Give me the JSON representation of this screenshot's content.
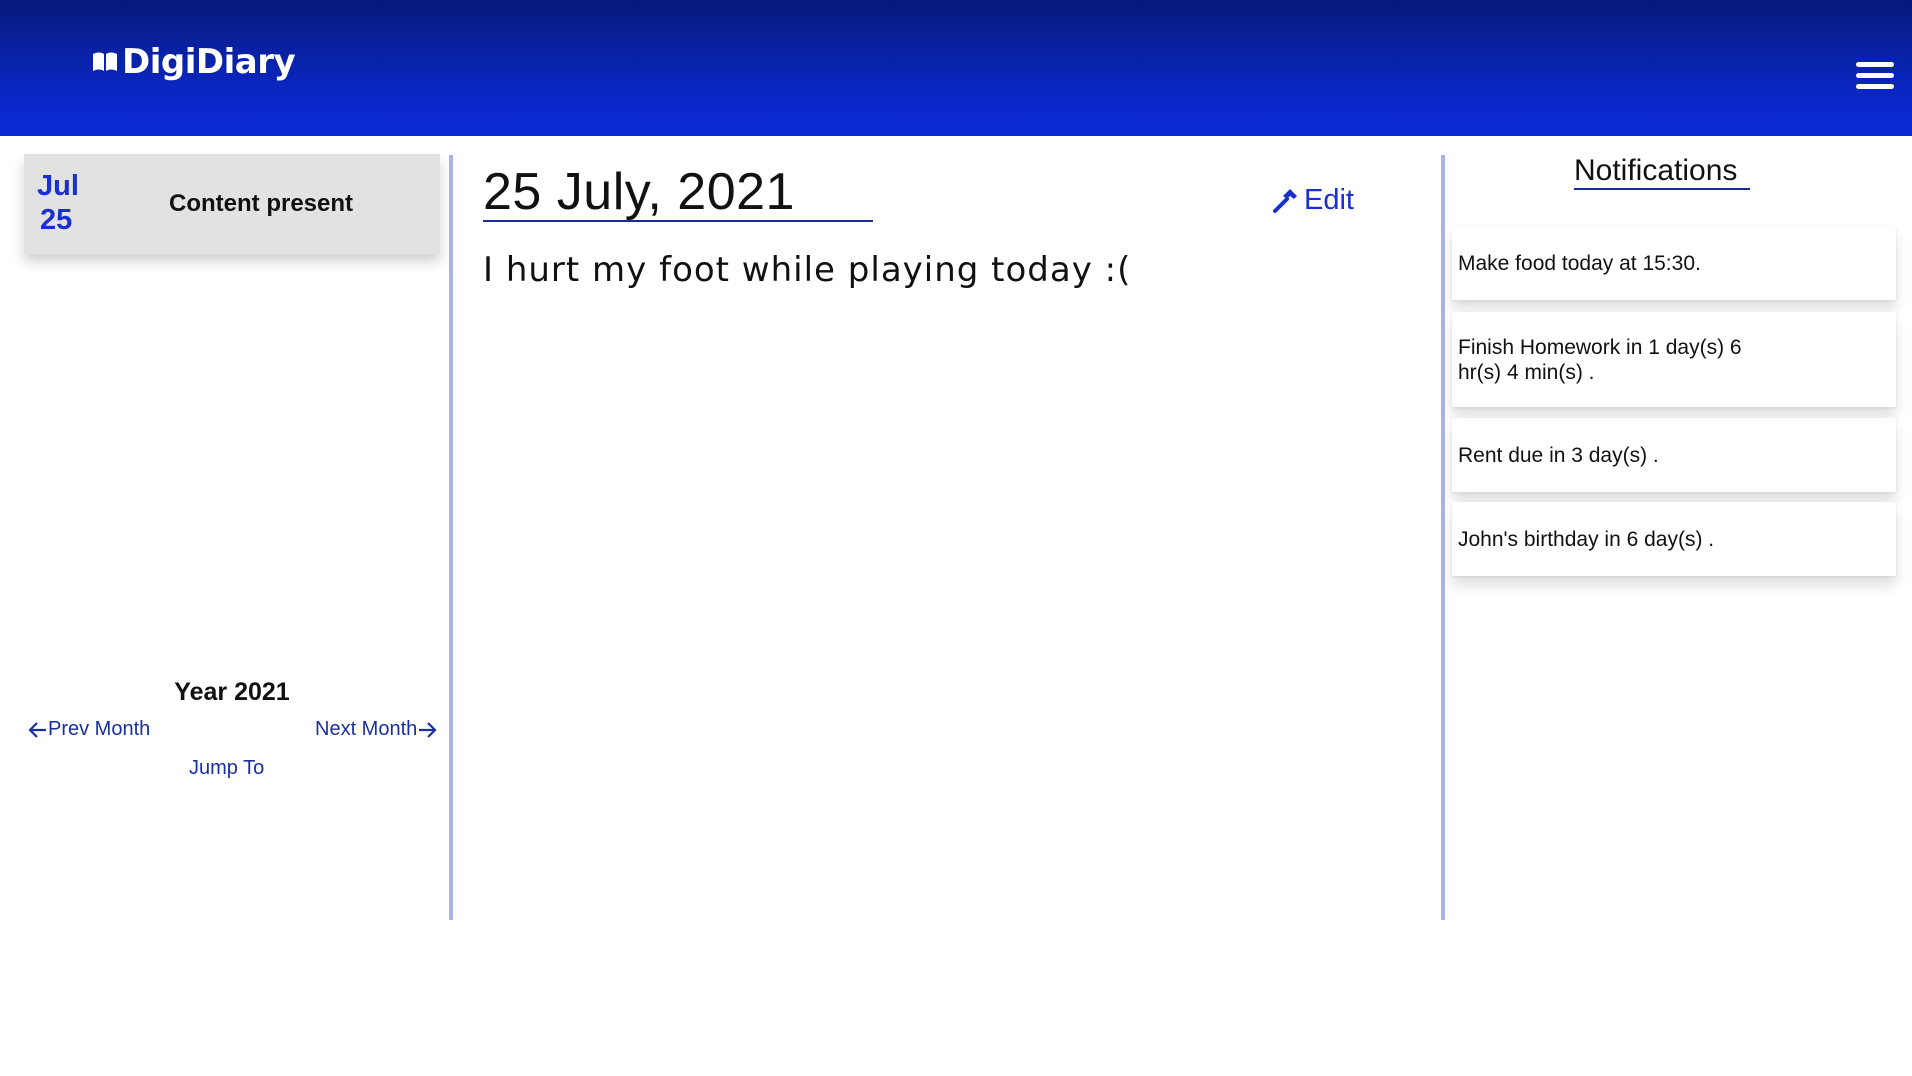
{
  "header": {
    "app_name": "DigiDiary",
    "logo_icon": "book-icon",
    "menu_icon": "hamburger-menu-icon",
    "gradient_colors": [
      "#061a7a",
      "#0b2ad6"
    ]
  },
  "sidebar": {
    "entries": [
      {
        "month": "Jul",
        "day": "25",
        "label": "Content present"
      }
    ],
    "year_label": "Year 2021",
    "prev_month": "Prev Month",
    "next_month": "Next Month",
    "jump_to": "Jump To"
  },
  "main": {
    "date_title": "25 July, 2021",
    "edit_label": "Edit",
    "edit_icon": "hammer-icon",
    "entry_text": "I hurt my foot while playing today :("
  },
  "notifications": {
    "title": "Notifications",
    "items": [
      "Make food today at 15:30.",
      "Finish Homework in 1 day(s) 6 hr(s) 4 min(s) .",
      "Rent due in 3 day(s) .",
      "John's birthday in 6 day(s) ."
    ]
  },
  "colors": {
    "accent": "#1a2fcf",
    "divider": "#a9b3e6",
    "card_gray": "#e2e2e2"
  }
}
